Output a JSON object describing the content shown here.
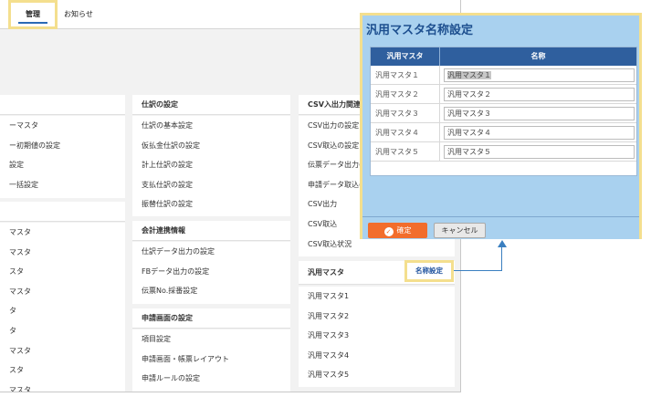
{
  "tabs": [
    {
      "label": "管理",
      "active": true
    },
    {
      "label": "お知らせ",
      "active": false
    }
  ],
  "left_column": {
    "section1": {
      "title": "",
      "items": [
        "ーマスタ",
        "ー初期値の設定",
        "設定",
        "一括設定"
      ]
    },
    "section2": {
      "title": "",
      "items": [
        "マスタ",
        "マスタ",
        "スタ",
        "マスタ",
        "タ",
        "タ",
        "マスタ",
        "スタ",
        "マスタ"
      ]
    }
  },
  "middle_column": {
    "section1": {
      "title": "仕訳の設定",
      "items": [
        "仕訳の基本設定",
        "仮払金仕訳の設定",
        "計上仕訳の設定",
        "支払仕訳の設定",
        "振替仕訳の設定"
      ]
    },
    "section2": {
      "title": "会計連携情報",
      "items": [
        "仕訳データ出力の設定",
        "FBデータ出力の設定",
        "伝票No.採番設定"
      ]
    },
    "section3": {
      "title": "申請画面の設定",
      "items": [
        "項目設定",
        "申請画面・帳票レイアウト",
        "申請ルールの設定"
      ]
    }
  },
  "right_column": {
    "section1": {
      "title": "CSV入出力関連",
      "items": [
        "CSV出力の設定",
        "CSV取込の設定",
        "伝票データ出力の",
        "申請データ取込の",
        "CSV出力",
        "CSV取込",
        "CSV取込状況"
      ]
    },
    "section2": {
      "title": "汎用マスタ",
      "action": "名称設定",
      "items": [
        "汎用マスタ1",
        "汎用マスタ2",
        "汎用マスタ3",
        "汎用マスタ4",
        "汎用マスタ5"
      ]
    }
  },
  "dialog": {
    "title": "汎用マスタ名称設定",
    "columns": [
      "汎用マスタ",
      "名称"
    ],
    "rows": [
      {
        "label": "汎用マスタ１",
        "value": "汎用マスタ１",
        "selected": true
      },
      {
        "label": "汎用マスタ２",
        "value": "汎用マスタ２",
        "selected": false
      },
      {
        "label": "汎用マスタ３",
        "value": "汎用マスタ３",
        "selected": false
      },
      {
        "label": "汎用マスタ４",
        "value": "汎用マスタ４",
        "selected": false
      },
      {
        "label": "汎用マスタ５",
        "value": "汎用マスタ５",
        "selected": false
      }
    ],
    "ok_label": "確定",
    "cancel_label": "キャンセル"
  },
  "colors": {
    "accent_highlight": "#f4df8e",
    "header_blue": "#2f5f9e",
    "dialog_bg": "#a9d1ef",
    "ok_orange": "#f26d2c"
  }
}
